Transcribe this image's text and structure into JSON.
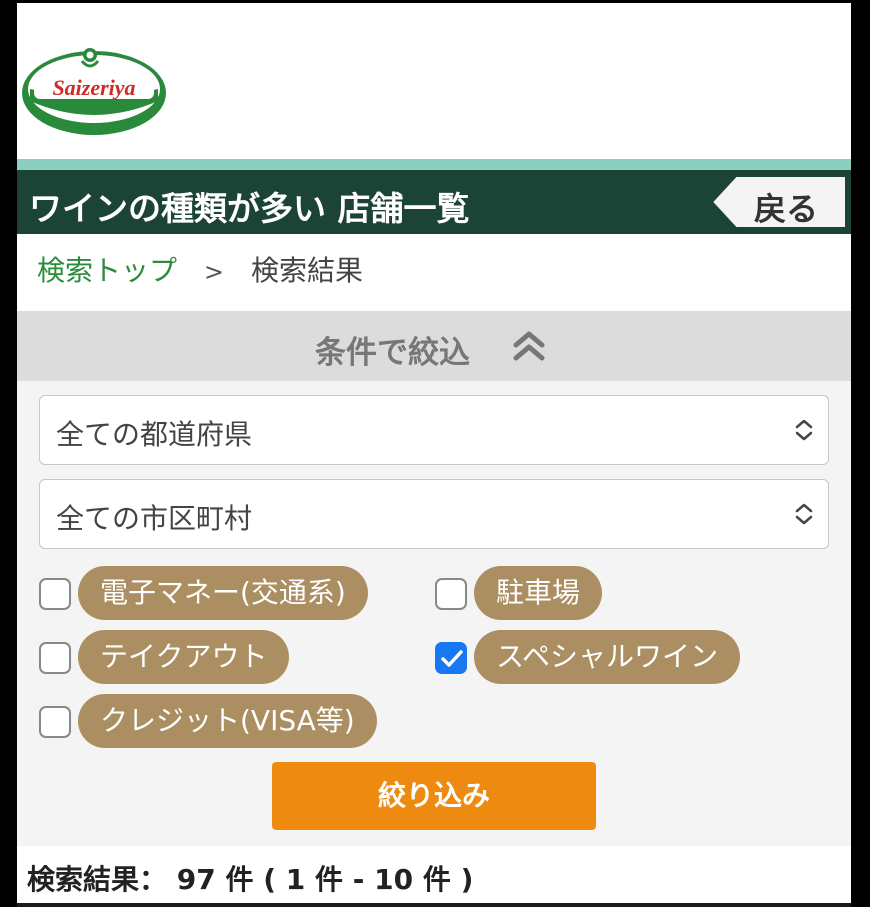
{
  "brand": {
    "logo_text": "Saizeriya",
    "colors": {
      "red": "#cf2a2a",
      "green": "#2a8a3b",
      "dark_green": "#1b4336",
      "teal": "#8ccfc1"
    }
  },
  "header": {
    "title": "ワインの種類が多い 店舗一覧",
    "back_label": "戻る"
  },
  "breadcrumb": {
    "top_link": "検索トップ",
    "separator": ">",
    "current": "検索結果"
  },
  "filter": {
    "heading": "条件で絞込",
    "toggle_icon": "chevron-double-up-icon",
    "prefecture_select": {
      "selected": "全ての都道府県"
    },
    "city_select": {
      "selected": "全ての市区町村"
    },
    "options": [
      {
        "label": "電子マネー(交通系)",
        "checked": false
      },
      {
        "label": "駐車場",
        "checked": false
      },
      {
        "label": "テイクアウト",
        "checked": false
      },
      {
        "label": "スペシャルワイン",
        "checked": true
      },
      {
        "label": "クレジット(VISA等)",
        "checked": false
      }
    ],
    "submit_label": "絞り込み",
    "accent_color": "#ef8a11",
    "pill_color": "#ab8f62"
  },
  "results": {
    "summary": "検索結果： 97 件 ( 1 件 - 10 件 )"
  }
}
